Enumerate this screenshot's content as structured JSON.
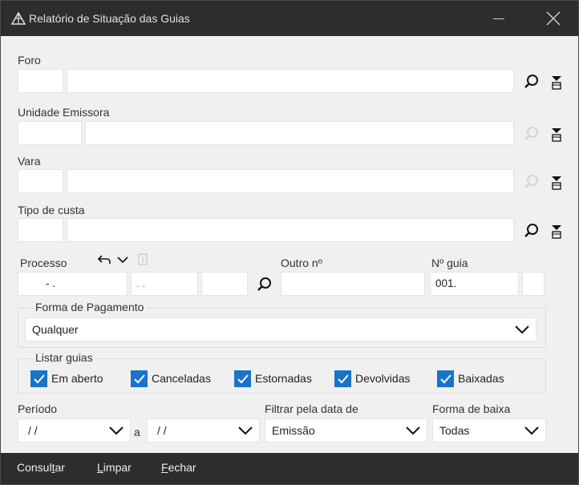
{
  "window": {
    "title": "Relatório de Situação das Guias",
    "icon": "scales-logo-icon"
  },
  "form": {
    "foro": {
      "label": "Foro",
      "code": "",
      "name": ""
    },
    "unidade_emissora": {
      "label": "Unidade Emissora",
      "code": "",
      "name": ""
    },
    "vara": {
      "label": "Vara",
      "code": "",
      "name": ""
    },
    "tipo_custa": {
      "label": "Tipo de custa",
      "code": "",
      "name": ""
    },
    "processo": {
      "label": "Processo",
      "part1": " - .",
      "part2": ". .",
      "part3": ""
    },
    "outro_numero": {
      "label": "Outro nº",
      "value": ""
    },
    "numero_guia": {
      "label": "Nº guia",
      "value": "001.",
      "suffix": ""
    },
    "forma_pagamento": {
      "label": "Forma de Pagamento",
      "selected": "Qualquer"
    },
    "listar_guias": {
      "label": "Listar guias",
      "options": [
        {
          "label": "Em aberto",
          "checked": true
        },
        {
          "label": "Canceladas",
          "checked": true
        },
        {
          "label": "Estornadas",
          "checked": true
        },
        {
          "label": "Devolvidas",
          "checked": true
        },
        {
          "label": "Baixadas",
          "checked": true
        }
      ]
    },
    "periodo": {
      "label": "Período",
      "from": "/ /",
      "separator": "a",
      "to": "/ /"
    },
    "filtrar_data": {
      "label": "Filtrar pela data de",
      "selected": "Emissão"
    },
    "forma_baixa": {
      "label": "Forma de baixa",
      "selected": "Todas"
    }
  },
  "actions": {
    "consultar": {
      "before": "Consul",
      "accel": "t",
      "after": "ar"
    },
    "limpar": {
      "accel": "L",
      "after": "impar"
    },
    "fechar": {
      "accel": "F",
      "after": "echar"
    }
  },
  "colors": {
    "titlebar": "#2d2d2d",
    "checkbox": "#1a73c9",
    "background": "#f0f0f0"
  }
}
